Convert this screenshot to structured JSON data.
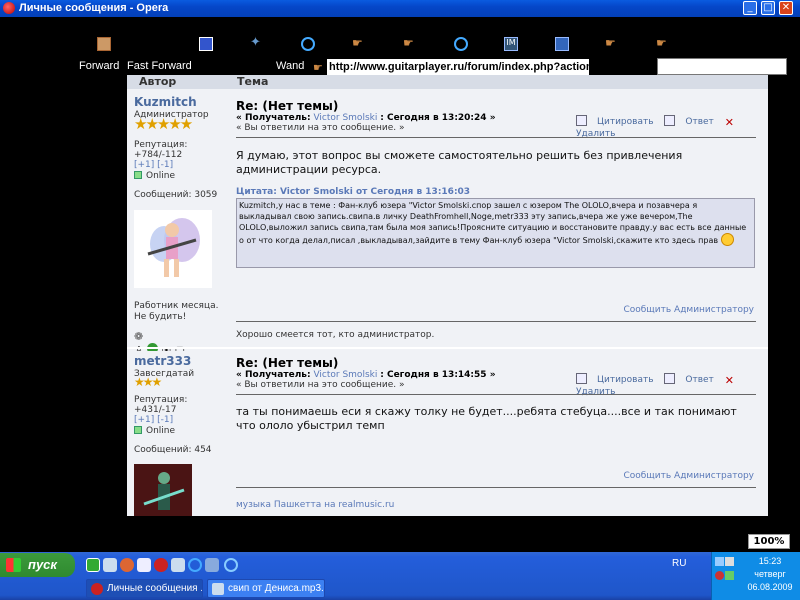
{
  "window": {
    "title": "Личные сообщения - Opera"
  },
  "toolbar": {
    "forward": "Forward",
    "fast_forward": "Fast Forward",
    "wand": "Wand",
    "address": "http://www.guitarplayer.ru/forum/index.php?action=p"
  },
  "table_header": {
    "author": "Автор",
    "topic": "Тема"
  },
  "post1": {
    "author": "Kuzmitch",
    "role": "Администратор",
    "stars": "★★★★★",
    "rep_label": "Репутация:",
    "rep_value": "+784/-112",
    "rep_links": "[+1] [-1]",
    "online": "Online",
    "messages": "Сообщений: 3059",
    "user_text": "Работник месяца. Не будить!",
    "title": "Re: (Нет темы)",
    "meta_prefix": "« Получатель:",
    "meta_recipient": "Victor Smolski",
    "meta_time": ": Сегодня в 13:20:24 »",
    "meta_replied": "« Вы ответили на это сообщение. »",
    "quote_btn": "Цитировать",
    "reply_btn": "Ответ",
    "delete_btn": "Удалить",
    "body": "Я думаю, этот вопрос вы сможете самостоятельно решить без привлечения администрации ресурса.",
    "quote_caption": "Цитата: Victor Smolski от Сегодня в 13:16:03",
    "quote_text": "Kuzmitch,у нас в теме : Фан-клуб юзера \"Victor Smolski.спор зашел с  юзером The OLOLO,вчера и позавчера я выкладывал свою запись.свипа.в личку DeathFromhell,Noge,metr333 эту запись,вчера же уже вечером,The OLOLO,выложил запись свипа,там была моя запись!Проясните ситуацию и восстановите правду.у вас есть все данные о от что когда делал,писал ,выкладывал,зайдите в тему Фан-клуб юзера \"Victor Smolski,скажите кто здесь прав",
    "report": "Сообщить Администратору",
    "signature": "Хорошо смеется тот, кто администратор."
  },
  "post2": {
    "author": "metr333",
    "role": "Завсегдатай",
    "stars": "★★★",
    "rep_label": "Репутация:",
    "rep_value": "+431/-17",
    "rep_links": "[+1] [-1]",
    "online": "Online",
    "messages": "Сообщений: 454",
    "title": "Re: (Нет темы)",
    "meta_prefix": "« Получатель:",
    "meta_recipient": "Victor Smolski",
    "meta_time": ": Сегодня в 13:14:55 »",
    "meta_replied": "« Вы ответили на это сообщение. »",
    "quote_btn": "Цитировать",
    "reply_btn": "Ответ",
    "delete_btn": "Удалить",
    "body": "та ты понимаешь еси я скажу толку не будет....ребята стебуца....все и так понимают что ололо убыстрил темп",
    "report": "Сообщить Администратору",
    "signature": "музыка Пашкетта на realmusic.ru"
  },
  "zoom": "100%",
  "taskbar": {
    "start": "пуск",
    "task1": "Личные сообщения ...",
    "task2": "свип от Дениса.mp3...",
    "lang": "RU",
    "time": "15:23",
    "day": "четверг",
    "date": "06.08.2009"
  },
  "colors": {
    "accent": "#4a6a9e",
    "link": "#5a79b8",
    "page_bg": "#f0f2f6",
    "taskbar": "#245edb"
  }
}
